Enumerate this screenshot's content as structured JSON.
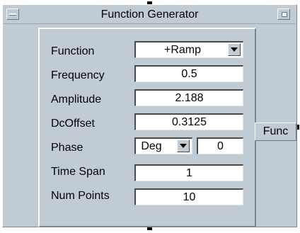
{
  "window": {
    "title": "Function Generator"
  },
  "fields": {
    "function": {
      "label": "Function",
      "value": "+Ramp"
    },
    "frequency": {
      "label": "Frequency",
      "value": "0.5"
    },
    "amplitude": {
      "label": "Amplitude",
      "value": "2.188"
    },
    "dcoffset": {
      "label": "DcOffset",
      "value": "0.3125"
    },
    "phase": {
      "label": "Phase",
      "unit": "Deg",
      "value": "0"
    },
    "time_span": {
      "label": "Time Span",
      "value": "1"
    },
    "num_points": {
      "label": "Num Points",
      "value": "10"
    }
  },
  "output_pin": {
    "label": "Func"
  },
  "icons": {
    "minimize": "minimize-icon",
    "maximize": "maximize-icon",
    "dropdown": "chevron-down-icon"
  }
}
